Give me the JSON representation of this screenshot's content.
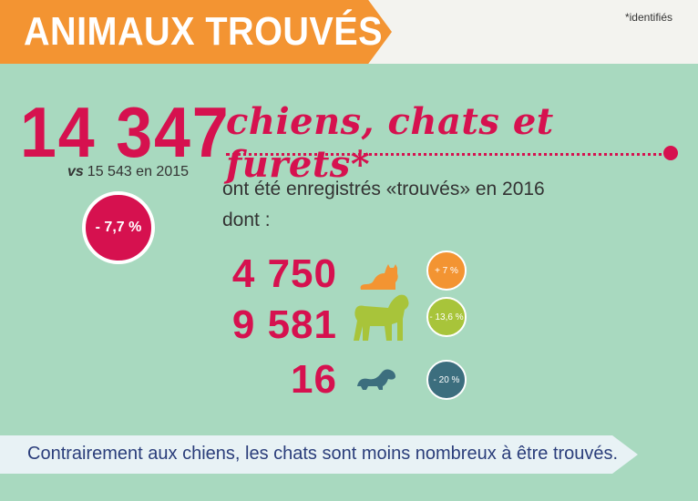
{
  "banner": {
    "title": "ANIMAUX TROUVÉS"
  },
  "footnote": "*identifiés",
  "headline": {
    "number": "14 347",
    "species": "chiens, chats et furets*",
    "vs_label": "vs",
    "previous": "15 543 en 2015",
    "change": "- 7,7 %"
  },
  "description": {
    "line1": "ont été enregistrés «trouvés» en 2016",
    "line2": "dont :"
  },
  "rows": [
    {
      "number": "4 750",
      "animal": "cat-icon",
      "change": "+ 7 %",
      "color": "#f39432"
    },
    {
      "number": "9 581",
      "animal": "dog-icon",
      "change": "- 13,6 %",
      "color": "#a8c43a"
    },
    {
      "number": "16",
      "animal": "ferret-icon",
      "change": "- 20 %",
      "color": "#3c6e7e"
    }
  ],
  "conclusion": "Contrairement aux chiens, les chats sont moins nombreux à être trouvés.",
  "colors": {
    "accent": "#d6114f",
    "background": "#a8d9bf",
    "banner": "#f39432"
  }
}
